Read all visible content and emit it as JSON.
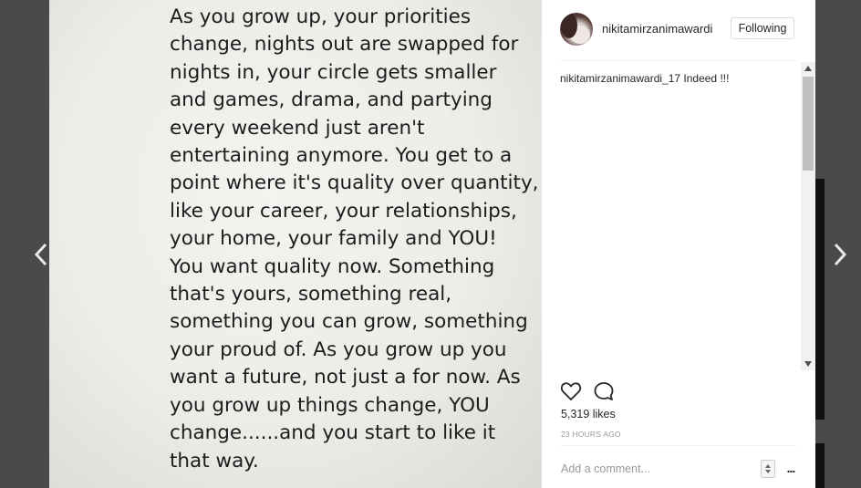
{
  "post": {
    "quote_lines": [
      "As you grow up, your priorities",
      "change, nights out are swapped for",
      "nights in, your circle gets smaller",
      "and games, drama, and partying",
      "every weekend just aren't",
      "entertaining anymore. You get to a",
      "point where it's quality over quantity,",
      "like your career, your relationships,",
      "your home, your family and YOU!",
      "You want quality now. Something",
      "that's yours, something real,",
      "something you can grow, something",
      "your proud of. As you grow up you",
      "want a future, not just a for now. As",
      "you grow up things change, YOU",
      "change......and you start to like it",
      "that way."
    ]
  },
  "header": {
    "username": "nikitamirzanimawardi",
    "follow_label": "Following"
  },
  "comments": [
    {
      "author": "nikitamirzanimawardi_17",
      "text": "Indeed !!!"
    }
  ],
  "stats": {
    "likes": "5,319 likes",
    "timestamp": "23 HOURS AGO"
  },
  "comment_box": {
    "placeholder": "Add a comment...",
    "more_label": "..."
  },
  "icons": {
    "prev": "chevron-left-icon",
    "next": "chevron-right-icon",
    "like": "heart-icon",
    "comment": "speech-bubble-icon"
  },
  "colors": {
    "backdrop": "#4a4a4a",
    "panel": "#ffffff",
    "text": "#262626",
    "muted": "#999999"
  }
}
